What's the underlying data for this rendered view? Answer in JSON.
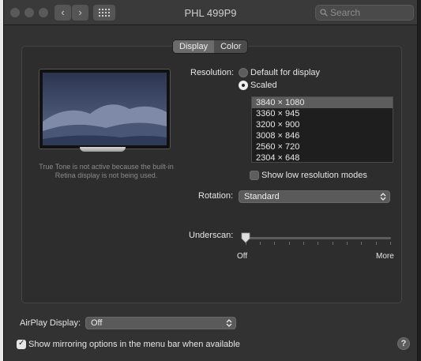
{
  "window": {
    "title": "PHL 499P9"
  },
  "toolbar": {
    "back_glyph": "‹",
    "forward_glyph": "›",
    "search": {
      "placeholder": "Search",
      "value": ""
    }
  },
  "tabs": [
    {
      "label": "Display",
      "selected": true
    },
    {
      "label": "Color",
      "selected": false
    }
  ],
  "true_tone_note": "True Tone is not active because the built-in Retina display is not being used.",
  "resolution": {
    "label": "Resolution:",
    "options": [
      {
        "label": "Default for display",
        "selected": false
      },
      {
        "label": "Scaled",
        "selected": true
      }
    ],
    "list": [
      {
        "label": "3840 × 1080",
        "selected": true
      },
      {
        "label": "3360 × 945",
        "selected": false
      },
      {
        "label": "3200 × 900",
        "selected": false
      },
      {
        "label": "3008 × 846",
        "selected": false
      },
      {
        "label": "2560 × 720",
        "selected": false
      },
      {
        "label": "2304 × 648",
        "selected": false
      }
    ],
    "show_low_res": {
      "label": "Show low resolution modes",
      "checked": false
    }
  },
  "rotation": {
    "label": "Rotation:",
    "value": "Standard"
  },
  "underscan": {
    "label": "Underscan:",
    "min_label": "Off",
    "max_label": "More",
    "value": 0
  },
  "airplay": {
    "label": "AirPlay Display:",
    "value": "Off"
  },
  "mirroring": {
    "label": "Show mirroring options in the menu bar when available",
    "checked": true
  },
  "help": {
    "label": "?"
  },
  "colors": {
    "window_bg": "#323232",
    "panel_bg": "#2d2d2d",
    "selection": "#5d5d5d"
  }
}
